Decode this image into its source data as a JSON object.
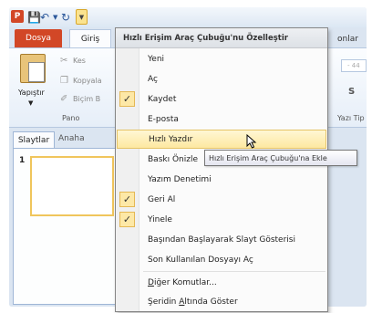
{
  "quick_access_toolbar": {
    "app_logo_letter": "P",
    "icons": [
      "powerpoint-logo-icon",
      "save-icon",
      "undo-icon",
      "dropdown-arrow-icon",
      "redo-icon",
      "customize-qat-icon"
    ]
  },
  "ribbon_tabs": {
    "file": "Dosya",
    "home": "Giriş",
    "animations_partial": "onlar"
  },
  "clipboard_group": {
    "paste": "Yapıştır",
    "cut": "Kes",
    "copy": "Kopyala",
    "format_painter": "Biçim B",
    "group_label": "Pano"
  },
  "font_group": {
    "font_box_partial": "- 44",
    "shadow_glyph": "S",
    "group_label_partial": "Yazı Tip"
  },
  "slide_panel": {
    "tab_slides": "Slaytlar",
    "tab_outline_partial": "Anaha",
    "slide_number": "1"
  },
  "menu": {
    "header": "Hızlı Erişim Araç Çubuğu'nu Özelleştir",
    "items": [
      {
        "label": "Yeni",
        "checked": false
      },
      {
        "label": "Aç",
        "checked": false
      },
      {
        "label": "Kaydet",
        "checked": true
      },
      {
        "label": "E-posta",
        "checked": false
      },
      {
        "label": "Hızlı Yazdır",
        "checked": false,
        "highlighted": true
      },
      {
        "label": "Baskı Önizle",
        "checked": false
      },
      {
        "label": "Yazım Denetimi",
        "checked": false
      },
      {
        "label": "Geri Al",
        "checked": true
      },
      {
        "label": "Yinele",
        "checked": true
      },
      {
        "label": "Başından Başlayarak Slayt Gösterisi",
        "checked": false
      },
      {
        "label": "Son Kullanılan Dosyayı Aç",
        "checked": false
      }
    ],
    "more_commands": {
      "underlined": "D",
      "rest": "iğer Komutlar..."
    },
    "show_below": {
      "pre": "Şeridin ",
      "underlined": "A",
      "rest": "ltında Göster"
    },
    "checkmark": "✓"
  },
  "tooltip": "Hızlı Erişim Araç Çubuğu'na Ekle"
}
